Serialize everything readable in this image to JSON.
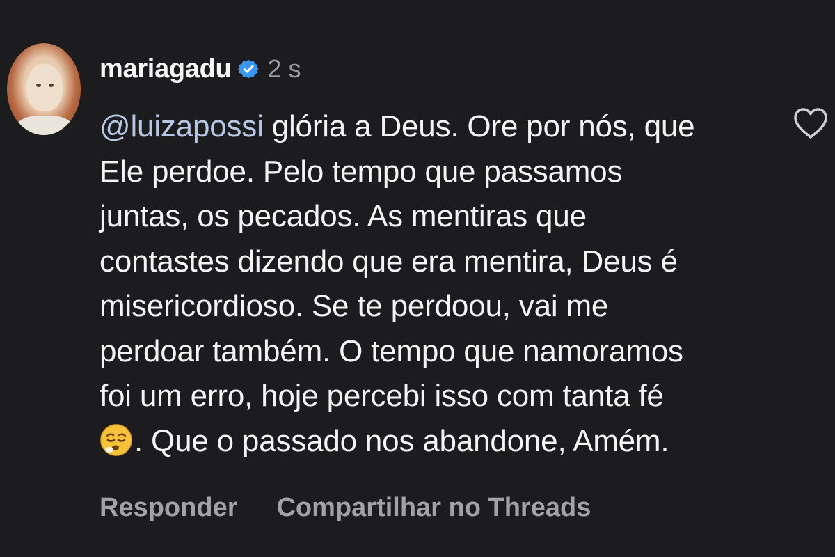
{
  "comment": {
    "username": "mariagadu",
    "verified_icon": "verified-badge-icon",
    "time": "2 s",
    "mention": "@luizapossi",
    "lines": [
      " glória a Deus.  Ore por nós, que",
      "Ele perdoe. Pelo tempo que passamos",
      "juntas, os pecados. As mentiras que",
      "contastes dizendo que era mentira, Deus é",
      "misericordioso. Se te perdoou, vai me",
      "perdoar também. O tempo que namoramos",
      "foi um erro, hoje percebi isso com tanta fé",
      ". Que o passado nos abandone,  Amém."
    ],
    "emoji": "relieved-face-emoji",
    "like_icon": "heart-outline-icon",
    "actions": {
      "reply": "Responder",
      "share_threads": "Compartilhar no Threads"
    }
  },
  "colors": {
    "background": "#1c1c1e",
    "mention": "#b6c7e6",
    "verified": "#3897f0",
    "muted": "#a2a2a6"
  }
}
